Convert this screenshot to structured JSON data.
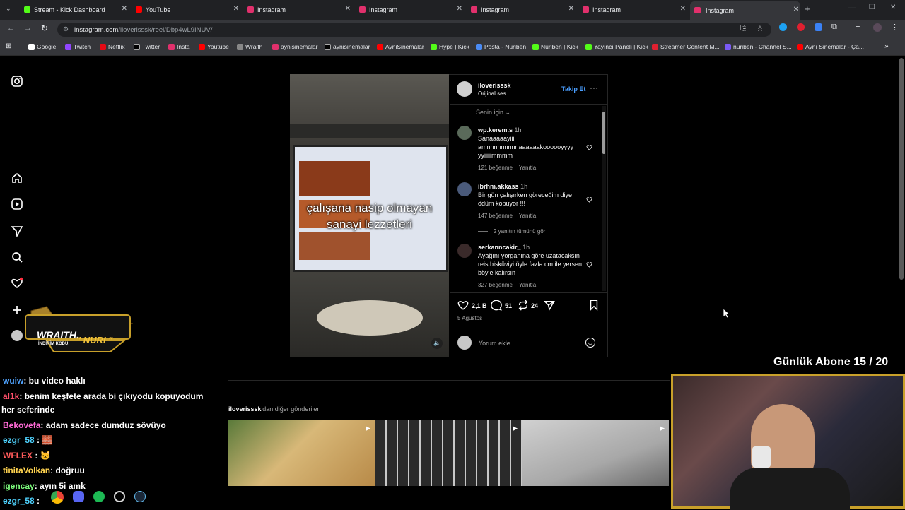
{
  "tabs": [
    {
      "label": "Stream - Kick Dashboard",
      "color": "#53fc18"
    },
    {
      "label": "YouTube",
      "color": "#ff0000"
    },
    {
      "label": "Instagram",
      "color": "#e1306c"
    },
    {
      "label": "Instagram",
      "color": "#e1306c"
    },
    {
      "label": "Instagram",
      "color": "#e1306c"
    },
    {
      "label": "Instagram",
      "color": "#e1306c"
    },
    {
      "label": "Instagram",
      "color": "#e1306c"
    }
  ],
  "url": {
    "host": "instagram.com",
    "path": "/iloverisssk/reel/Dbp4wL9INUV/"
  },
  "bookmarks": [
    "Google",
    "Twitch",
    "Netflix",
    "Twitter",
    "Insta",
    "Youtube",
    "Wraith",
    "aynisinemalar",
    "aynisinemalar",
    "AyniSinemalar",
    "Hype | Kick",
    "Posta - Nuriben",
    "Nuriben | Kick",
    "Yayıncı Paneli | Kick",
    "Streamer Content M...",
    "nuriben - Channel S...",
    "Aynı Sinemalar - Ça..."
  ],
  "video": {
    "caption_line1": "çalışana nasip olmayan",
    "caption_line2": "sanayi lezzetleri"
  },
  "post": {
    "username": "iloverisssk",
    "audio": "Orijinal ses",
    "follow": "Takip Et",
    "sort": "Senin için",
    "comments": [
      {
        "user": "wp.kerem.s",
        "time": "1h",
        "text": "Sanaaaaayiiii amnnnnnnnnnaaaaaakoooooyyyy yyiiiiimmmm",
        "likes": "121 beğenme",
        "reply": "Yanıtla"
      },
      {
        "user": "ibrhm.akkass",
        "time": "1h",
        "text": "Bir gün çalışırken göreceğim diye ödüm kopuyor !!!",
        "likes": "147 beğenme",
        "reply": "Yanıtla",
        "replies": "2 yanıtın tümünü gör"
      },
      {
        "user": "serkanncakir_",
        "time": "1h",
        "text": "Ayağını yorganına göre uzatacaksın reis bisküviyi öyle fazla cm ile yersen böyle kalırsın",
        "likes": "327 beğenme",
        "reply": "Yanıtla"
      }
    ],
    "like_count": "2,1 B",
    "comment_count": "51",
    "share_count": "24",
    "date": "5 Ağustos",
    "comment_placeholder": "Yorum ekle..."
  },
  "more_posts": {
    "owner": "iloverisssk",
    "suffix": "'dan diğer gönderiler"
  },
  "overlay": {
    "sub_goal": "Günlük Abone 15 / 20",
    "sponsor": "WRAITH.",
    "sponsor_code_label": "İNDİRİM KODU:",
    "sponsor_code": "\" NURI \""
  },
  "chat": [
    {
      "user": "wuiw",
      "color": "#4fa3ff",
      "msg": ": bu video haklı"
    },
    {
      "user": "al1k",
      "color": "#ff4f6a",
      "msg": ": benim keşfete arada bi çıkıyodu kopuyodum"
    },
    {
      "user": "",
      "color": "#fff",
      "msg": "her seferinde"
    },
    {
      "user": "Bekovefa",
      "color": "#ff6ad5",
      "msg": ": adam sadece dumduz sövüyo"
    },
    {
      "user": "ezgr_58",
      "color": "#4fd3ff",
      "msg": " : 🧱"
    },
    {
      "user": "WFLEX",
      "color": "#ff5a5a",
      "msg": " : 🐱"
    },
    {
      "user": "tinitaVolkan",
      "color": "#ffd34f",
      "msg": ": doğruu"
    },
    {
      "user": "igencay",
      "color": "#7fff7f",
      "msg": ": ayın 5i amk"
    },
    {
      "user": "ezgr_58",
      "color": "#4fd3ff",
      "msg": " :"
    }
  ]
}
